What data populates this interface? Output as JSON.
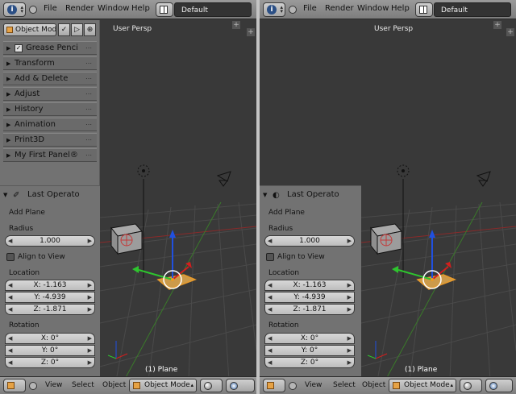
{
  "topbar": {
    "menus": [
      "File",
      "Render",
      "Window",
      "Help"
    ],
    "layout": "Default"
  },
  "toolshelf": {
    "mode": "Object Mod",
    "panels": [
      "Grease Penci",
      "Transform",
      "Add & Delete",
      "Adjust",
      "History",
      "Animation",
      "Print3D",
      "My First Panel®"
    ],
    "grip": "⋯"
  },
  "operator": {
    "title": "Last Operato",
    "name": "Add Plane",
    "radius_label": "Radius",
    "radius_value": "1.000",
    "align_label": "Align to View",
    "location_label": "Location",
    "location": [
      "X: -1.163",
      "Y: -4.939",
      "Z: -1.871"
    ],
    "rotation_label": "Rotation",
    "rotation": [
      "X: 0°",
      "Y: 0°",
      "Z: 0°"
    ]
  },
  "viewport": {
    "title": "User Persp",
    "object": "(1) Plane",
    "plus": "+"
  },
  "bottombar": {
    "items": [
      "View",
      "Select",
      "Object"
    ],
    "mode": "Object Mode"
  },
  "colors": {
    "x_axis": "#d21e1e",
    "y_axis": "#2ec42e",
    "z_axis": "#2050e0",
    "selection": "#e89a2a"
  }
}
